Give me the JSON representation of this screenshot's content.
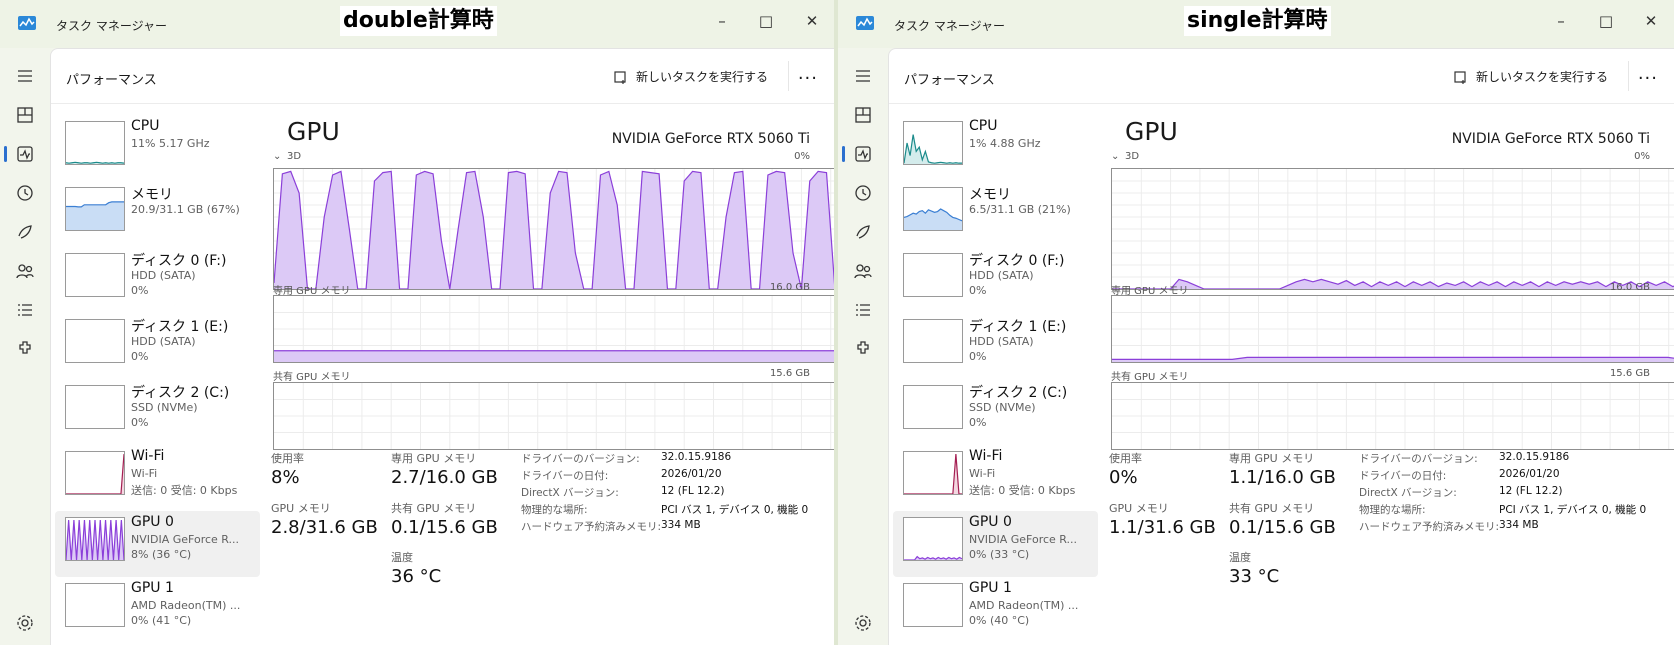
{
  "colors": {
    "gpu": "#8b3fd9",
    "gpu_fill": "#dcc9f6",
    "mem": "#3b7fd3",
    "mem_fill": "#c9ddf5",
    "cpu": "#1b8b8b",
    "wifi": "#a41e52"
  },
  "windows": [
    {
      "app_title": "タスク マネージャー",
      "overlay_label": "double計算時",
      "page_title": "パフォーマンス",
      "new_task": "新しいタスクを実行する",
      "more": "...",
      "items": [
        {
          "name": "CPU",
          "sub": "11%  5.17 GHz",
          "sub2": ""
        },
        {
          "name": "メモリ",
          "sub": "20.9/31.1 GB (67%)",
          "sub2": ""
        },
        {
          "name": "ディスク 0 (F:)",
          "sub": "HDD (SATA)",
          "sub2": "0%"
        },
        {
          "name": "ディスク 1 (E:)",
          "sub": "HDD (SATA)",
          "sub2": "0%"
        },
        {
          "name": "ディスク 2 (C:)",
          "sub": "SSD (NVMe)",
          "sub2": "0%"
        },
        {
          "name": "Wi-Fi",
          "sub": "Wi-Fi",
          "sub2": "送信: 0 受信: 0 Kbps"
        },
        {
          "name": "GPU 0",
          "sub": "NVIDIA GeForce R...",
          "sub2": "8% (36 °C)"
        },
        {
          "name": "GPU 1",
          "sub": "AMD Radeon(TM) ...",
          "sub2": "0% (41 °C)"
        }
      ],
      "detail": {
        "title": "GPU",
        "model": "NVIDIA GeForce RTX 5060 Ti",
        "engine_label": "3D",
        "engine_max": "0%",
        "dedicated_label": "専用 GPU メモリ",
        "dedicated_max": "16.0 GB",
        "shared_label": "共有 GPU メモリ",
        "shared_max": "15.6 GB",
        "usage_label": "使用率",
        "usage": "8%",
        "dedicated_stat_label": "専用 GPU メモリ",
        "dedicated_stat": "2.7/16.0 GB",
        "gpumem_label": "GPU メモリ",
        "gpumem": "2.8/31.6 GB",
        "shared_stat_label": "共有 GPU メモリ",
        "shared_stat": "0.1/15.6 GB",
        "temp_label": "温度",
        "temp": "36 °C",
        "info": [
          {
            "k": "ドライバーのバージョン:",
            "v": "32.0.15.9186"
          },
          {
            "k": "ドライバーの日付:",
            "v": "2026/01/20"
          },
          {
            "k": "DirectX バージョン:",
            "v": "12 (FL 12.2)"
          },
          {
            "k": "物理的な場所:",
            "v": "PCI バス 1, デバイス 0, 機能 0"
          },
          {
            "k": "ハードウェア予約済みメモリ:",
            "v": "334 MB"
          }
        ]
      }
    },
    {
      "app_title": "タスク マネージャー",
      "overlay_label": "single計算時",
      "page_title": "パフォーマンス",
      "new_task": "新しいタスクを実行する",
      "more": "...",
      "items": [
        {
          "name": "CPU",
          "sub": "1%  4.88 GHz",
          "sub2": ""
        },
        {
          "name": "メモリ",
          "sub": "6.5/31.1 GB (21%)",
          "sub2": ""
        },
        {
          "name": "ディスク 0 (F:)",
          "sub": "HDD (SATA)",
          "sub2": "0%"
        },
        {
          "name": "ディスク 1 (E:)",
          "sub": "HDD (SATA)",
          "sub2": "0%"
        },
        {
          "name": "ディスク 2 (C:)",
          "sub": "SSD (NVMe)",
          "sub2": "0%"
        },
        {
          "name": "Wi-Fi",
          "sub": "Wi-Fi",
          "sub2": "送信: 0 受信: 0 Kbps"
        },
        {
          "name": "GPU 0",
          "sub": "NVIDIA GeForce R...",
          "sub2": "0% (33 °C)"
        },
        {
          "name": "GPU 1",
          "sub": "AMD Radeon(TM) ...",
          "sub2": "0% (40 °C)"
        }
      ],
      "detail": {
        "title": "GPU",
        "model": "NVIDIA GeForce RTX 5060 Ti",
        "engine_label": "3D",
        "engine_max": "0%",
        "dedicated_label": "専用 GPU メモリ",
        "dedicated_max": "16.0 GB",
        "shared_label": "共有 GPU メモリ",
        "shared_max": "15.6 GB",
        "usage_label": "使用率",
        "usage": "0%",
        "dedicated_stat_label": "専用 GPU メモリ",
        "dedicated_stat": "1.1/16.0 GB",
        "gpumem_label": "GPU メモリ",
        "gpumem": "1.1/31.6 GB",
        "shared_stat_label": "共有 GPU メモリ",
        "shared_stat": "0.1/15.6 GB",
        "temp_label": "温度",
        "temp": "33 °C",
        "info": [
          {
            "k": "ドライバーのバージョン:",
            "v": "32.0.15.9186"
          },
          {
            "k": "ドライバーの日付:",
            "v": "2026/01/20"
          },
          {
            "k": "DirectX バージョン:",
            "v": "12 (FL 12.2)"
          },
          {
            "k": "物理的な場所:",
            "v": "PCI バス 1, デバイス 0, 機能 0"
          },
          {
            "k": "ハードウェア予約済みメモリ:",
            "v": "334 MB"
          }
        ]
      }
    }
  ],
  "series": {
    "double_3d": [
      5,
      96,
      98,
      80,
      0,
      0,
      60,
      95,
      98,
      50,
      0,
      0,
      90,
      97,
      98,
      0,
      0,
      95,
      98,
      96,
      40,
      0,
      50,
      97,
      98,
      60,
      0,
      0,
      97,
      98,
      96,
      0,
      0,
      80,
      98,
      97,
      30,
      0,
      0,
      95,
      98,
      70,
      0,
      0,
      98,
      97,
      96,
      0,
      0,
      90,
      98,
      97,
      0,
      0,
      60,
      97,
      98,
      0,
      0,
      95,
      98,
      97,
      30,
      0,
      90,
      98,
      97,
      0,
      0,
      95,
      98
    ],
    "single_3d": [
      0,
      0,
      0,
      0,
      0,
      0,
      0,
      0,
      8,
      6,
      3,
      0,
      0,
      0,
      0,
      0,
      0,
      0,
      0,
      0,
      0,
      3,
      6,
      8,
      6,
      8,
      6,
      4,
      7,
      3,
      6,
      2,
      6,
      3,
      6,
      2,
      6,
      3,
      6,
      2,
      5,
      3,
      6,
      2,
      6,
      3,
      6,
      2,
      6,
      3,
      6,
      2,
      6,
      3,
      6,
      4,
      6,
      4,
      6,
      2,
      6,
      3,
      6,
      2,
      6,
      3,
      6,
      2,
      5,
      2,
      4
    ],
    "double_dedicated": 17,
    "single_dedicated": 7,
    "single_dedicated_prev": 4,
    "cpu_double": [
      3,
      2,
      3,
      4,
      3,
      2,
      3,
      3,
      2,
      3,
      4,
      3,
      2,
      3,
      2,
      3,
      2,
      3,
      3,
      2
    ],
    "cpu_single": [
      2,
      50,
      20,
      70,
      30,
      40,
      10,
      30,
      5,
      3,
      2,
      3,
      4,
      3,
      2,
      3,
      2,
      3,
      2,
      2
    ],
    "mem_double": [
      56,
      56,
      56,
      56,
      55,
      55,
      60,
      60,
      60,
      60,
      60,
      60,
      60,
      60,
      65,
      67,
      67,
      67,
      67,
      67
    ],
    "mem_single": [
      30,
      32,
      36,
      40,
      38,
      44,
      46,
      40,
      48,
      45,
      42,
      44,
      50,
      46,
      42,
      35,
      30,
      28,
      25,
      22
    ],
    "wifi_double": [
      0,
      0,
      0,
      0,
      0,
      0,
      0,
      0,
      0,
      0,
      0,
      0,
      0,
      0,
      0,
      0,
      0,
      0,
      0,
      95
    ],
    "wifi_single": [
      0,
      0,
      0,
      0,
      0,
      0,
      0,
      0,
      0,
      0,
      0,
      0,
      0,
      0,
      0,
      0,
      0,
      95,
      0,
      0
    ],
    "gpu_thumb_double": [
      0,
      95,
      0,
      95,
      0,
      95,
      0,
      95,
      0,
      95,
      0,
      95,
      0,
      95,
      0,
      95,
      0,
      95,
      0,
      95,
      0,
      95,
      0
    ],
    "gpu_thumb_single": [
      0,
      0,
      0,
      0,
      0,
      8,
      3,
      5,
      2,
      6,
      3,
      5,
      2,
      6,
      3,
      5,
      2,
      6,
      3,
      5,
      2,
      6,
      3
    ]
  }
}
